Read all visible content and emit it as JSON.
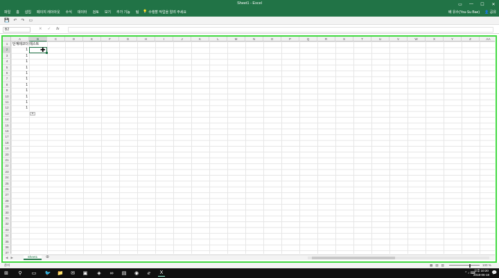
{
  "window": {
    "title": "Sheet1 - Excel",
    "controls": {
      "ribbon_display": "▭",
      "minimize": "—",
      "maximize": "☐",
      "close": "✕"
    }
  },
  "ribbon": {
    "tabs": [
      "파일",
      "홈",
      "삽입",
      "페이지 레이아웃",
      "수식",
      "데이터",
      "검토",
      "보기",
      "추가 기능",
      "팀"
    ],
    "search_text": "수행할 작업을 알려 주세요",
    "user": "배 유수(You-Su Bae)",
    "share": "공유"
  },
  "formula_bar": {
    "name_box": "B2",
    "cancel": "✕",
    "enter": "✓",
    "fx": "fx",
    "value": ""
  },
  "grid": {
    "columns": [
      "A",
      "B",
      "C",
      "D",
      "E",
      "F",
      "G",
      "H",
      "I",
      "J",
      "K",
      "L",
      "M",
      "N",
      "O",
      "P",
      "Q",
      "R",
      "S",
      "T",
      "U",
      "V",
      "W",
      "X",
      "Y",
      "Z",
      "AA"
    ],
    "rows": [
      "1",
      "2",
      "3",
      "4",
      "5",
      "6",
      "7",
      "8",
      "9",
      "10",
      "11",
      "12",
      "13",
      "14",
      "15",
      "16",
      "17",
      "18",
      "19",
      "20",
      "21",
      "22",
      "23",
      "24",
      "25",
      "26",
      "27",
      "28",
      "29",
      "30",
      "31",
      "32",
      "33",
      "34",
      "35",
      "36",
      "37"
    ],
    "selected_cell": "B2",
    "a1_text": "단계레코더 테스트",
    "column_a_values": [
      "1",
      "1",
      "1",
      "1",
      "1",
      "1",
      "1",
      "1",
      "1",
      "1",
      "1"
    ]
  },
  "sheets": {
    "tabs": [
      "Sheet1"
    ],
    "add": "⊕"
  },
  "status": {
    "ready": "준비",
    "zoom": "100 %"
  },
  "taskbar": {
    "time": "오후 10:20",
    "date": "2018-06-18"
  },
  "colors": {
    "excel_green": "#217346",
    "highlight_frame": "#3fd93f",
    "taskbar": "#101010"
  }
}
